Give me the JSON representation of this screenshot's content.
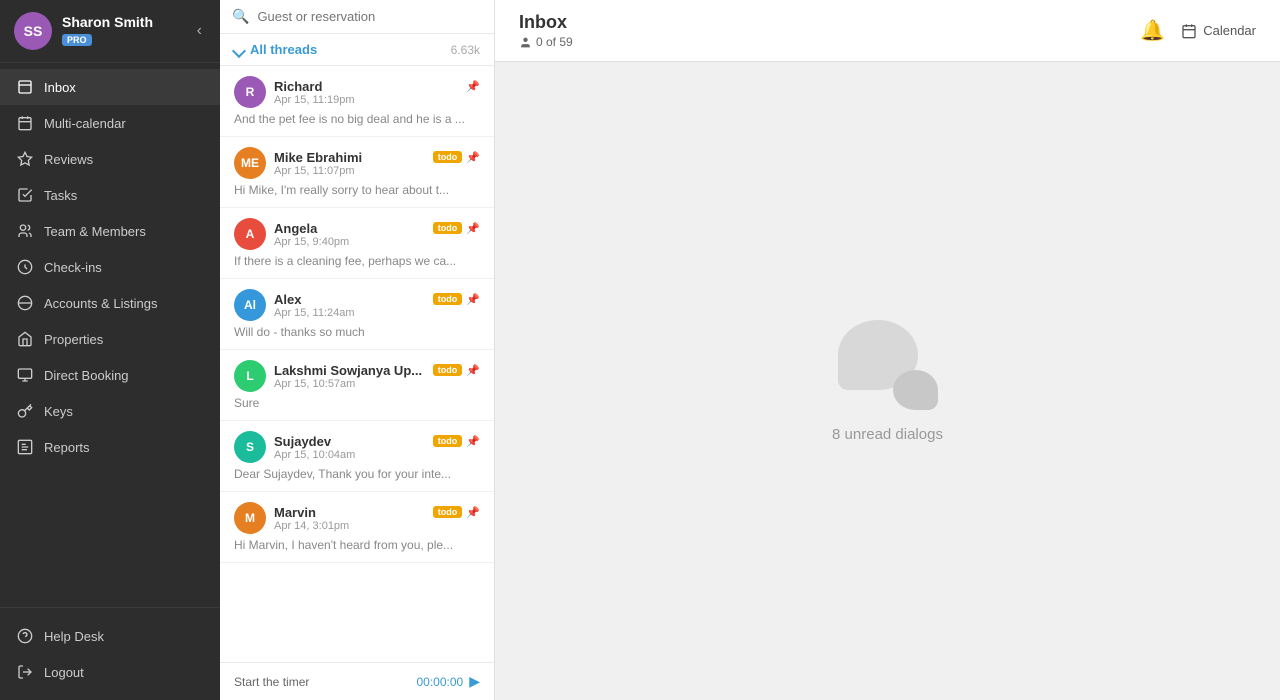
{
  "sidebar": {
    "user": {
      "name": "Sharon Smith",
      "pro_badge": "PRO",
      "initials": "SS"
    },
    "nav_items": [
      {
        "id": "inbox",
        "label": "Inbox",
        "icon": "inbox",
        "active": true
      },
      {
        "id": "multi-calendar",
        "label": "Multi-calendar",
        "icon": "calendar"
      },
      {
        "id": "reviews",
        "label": "Reviews",
        "icon": "star"
      },
      {
        "id": "tasks",
        "label": "Tasks",
        "icon": "tasks"
      },
      {
        "id": "team-members",
        "label": "Team & Members",
        "icon": "team"
      },
      {
        "id": "check-ins",
        "label": "Check-ins",
        "icon": "checkin"
      },
      {
        "id": "accounts-listings",
        "label": "Accounts & Listings",
        "icon": "list"
      },
      {
        "id": "properties",
        "label": "Properties",
        "icon": "home"
      },
      {
        "id": "direct-booking",
        "label": "Direct Booking",
        "icon": "booking"
      },
      {
        "id": "keys",
        "label": "Keys",
        "icon": "key"
      },
      {
        "id": "reports",
        "label": "Reports",
        "icon": "reports"
      }
    ],
    "footer_items": [
      {
        "id": "help-desk",
        "label": "Help Desk",
        "icon": "help"
      },
      {
        "id": "logout",
        "label": "Logout",
        "icon": "logout"
      }
    ]
  },
  "search": {
    "placeholder": "Guest or reservation"
  },
  "threads": {
    "filter_label": "All threads",
    "count": "6.63k",
    "items": [
      {
        "id": 1,
        "name": "Richard",
        "time": "Apr 15, 11:19pm",
        "preview": "And the pet fee is no big deal and he is a ...",
        "pinned": true,
        "todo": false,
        "initials": "R",
        "av_class": "av-r"
      },
      {
        "id": 2,
        "name": "Mike Ebrahimi",
        "time": "Apr 15, 11:07pm",
        "preview": "Hi Mike, I'm really sorry to hear about t...",
        "pinned": true,
        "todo": true,
        "initials": "ME",
        "av_class": "av-m"
      },
      {
        "id": 3,
        "name": "Angela",
        "time": "Apr 15, 9:40pm",
        "preview": "If there is a cleaning fee, perhaps we ca...",
        "pinned": true,
        "todo": true,
        "initials": "A",
        "av_class": "av-a"
      },
      {
        "id": 4,
        "name": "Alex",
        "time": "Apr 15, 11:24am",
        "preview": "Will do - thanks so much",
        "pinned": true,
        "todo": true,
        "initials": "Al",
        "av_class": "av-al"
      },
      {
        "id": 5,
        "name": "Lakshmi Sowjanya Up...",
        "time": "Apr 15, 10:57am",
        "preview": "Sure",
        "pinned": true,
        "todo": true,
        "initials": "L",
        "av_class": "av-l"
      },
      {
        "id": 6,
        "name": "Sujaydev",
        "time": "Apr 15, 10:04am",
        "preview": "Dear Sujaydev, Thank you for your inte...",
        "pinned": true,
        "todo": true,
        "initials": "S",
        "av_class": "av-s"
      },
      {
        "id": 7,
        "name": "Marvin",
        "time": "Apr 14, 3:01pm",
        "preview": "Hi Marvin, I haven't heard from you, ple...",
        "pinned": true,
        "todo": true,
        "initials": "M",
        "av_class": "av-mv"
      }
    ]
  },
  "timer": {
    "label": "Start the timer",
    "time": "00:00:00"
  },
  "main": {
    "title": "Inbox",
    "sub_icon": "person",
    "sub_text": "0 of 59",
    "empty_text": "8 unread dialogs",
    "bell_label": "Notifications",
    "calendar_label": "Calendar"
  }
}
